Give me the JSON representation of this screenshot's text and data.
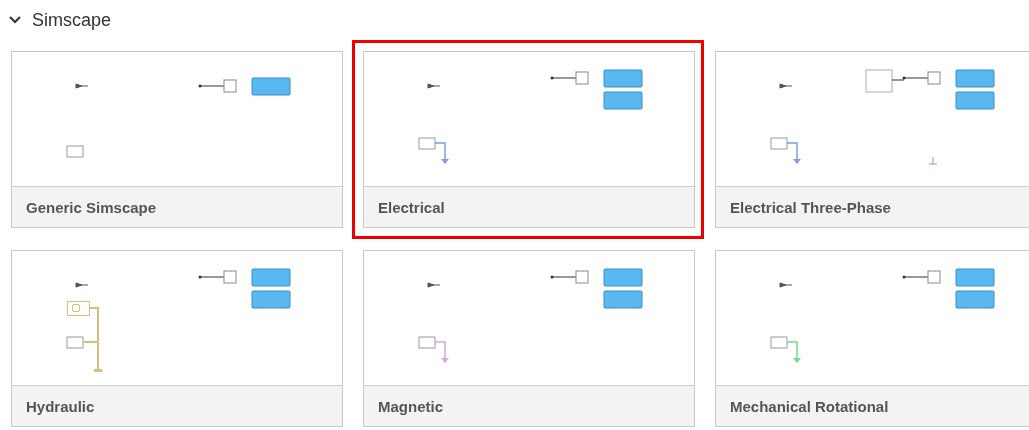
{
  "section": {
    "title": "Simscape",
    "expanded": true
  },
  "cards": [
    {
      "title": "Generic Simscape",
      "selected": false,
      "kind": "generic"
    },
    {
      "title": "Electrical",
      "selected": true,
      "kind": "grounded",
      "color": "#7f9ee0"
    },
    {
      "title": "Electrical Three-Phase",
      "selected": false,
      "kind": "three-phase",
      "color": "#7f9ee0"
    },
    {
      "title": "Hydraulic",
      "selected": false,
      "kind": "hydraulic",
      "color": "#d8bf7a"
    },
    {
      "title": "Magnetic",
      "selected": false,
      "kind": "grounded",
      "color": "#d9a6e0"
    },
    {
      "title": "Mechanical Rotational",
      "selected": false,
      "kind": "grounded",
      "color": "#6fdc8f"
    }
  ]
}
